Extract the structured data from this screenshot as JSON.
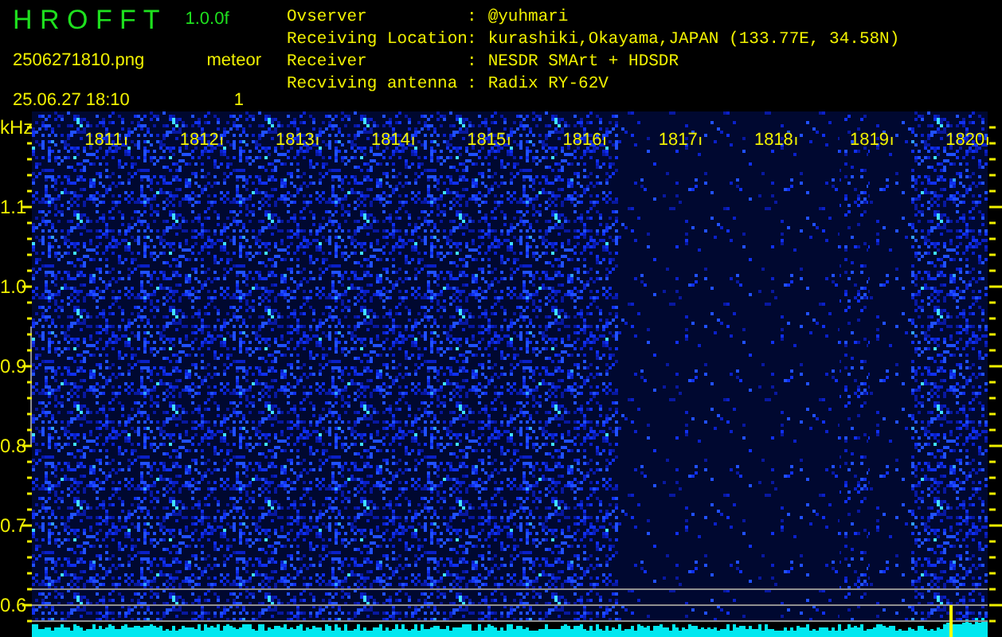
{
  "app": {
    "name": "H R O F F T",
    "version": "1.0.0f",
    "file": "2506271810.png",
    "datetime": "25.06.27 18:10",
    "mode_label": "meteor",
    "count": "1"
  },
  "info": [
    {
      "label": "Ovserver",
      "sep": ":",
      "value": "@yuhmari"
    },
    {
      "label": "Receiving Location",
      "sep": ":",
      "value": "kurashiki,Okayama,JAPAN (133.77E, 34.58N)"
    },
    {
      "label": "Receiver",
      "sep": ":",
      "value": "NESDR SMArt + HDSDR"
    },
    {
      "label": "Recviving antenna",
      "sep": ":",
      "value": "Radix RY-62V"
    }
  ],
  "spectrogram": {
    "unit": "kHz",
    "frequency_labels": [
      "1.1",
      "1.0",
      "0.9",
      "0.8",
      "0.7",
      "0.6"
    ],
    "time_labels": [
      "1811",
      "1812",
      "1813",
      "1814",
      "1815",
      "1816",
      "1817",
      "1818",
      "1819",
      "1820"
    ]
  }
}
